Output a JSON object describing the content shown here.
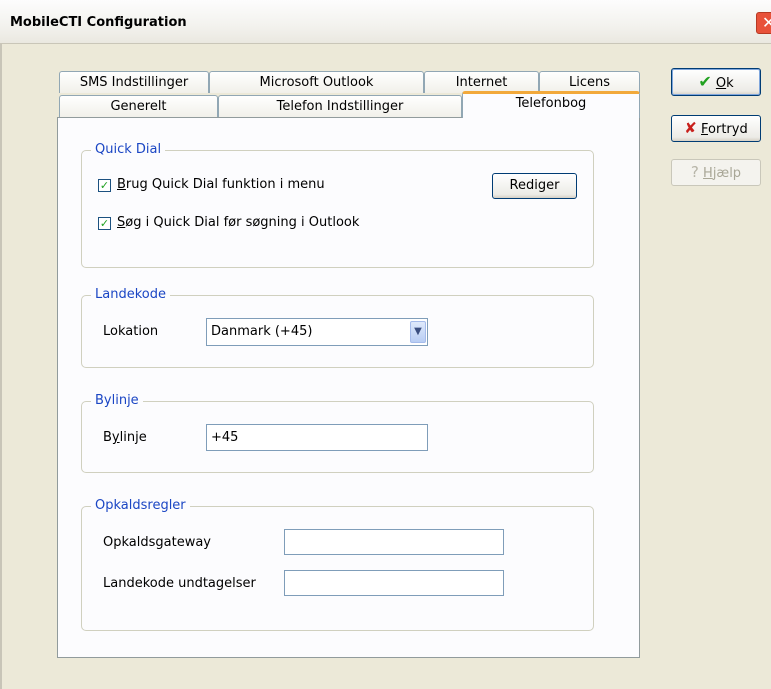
{
  "window": {
    "title": "MobileCTI Configuration",
    "close_glyph": "✕"
  },
  "tabs": {
    "row_back": [
      {
        "label": "SMS Indstillinger"
      },
      {
        "label": "Microsoft Outlook"
      },
      {
        "label": "Internet"
      },
      {
        "label": "Licens"
      }
    ],
    "row_front": [
      {
        "label": "Generelt"
      },
      {
        "label": "Telefon Indstillinger"
      },
      {
        "label": "Telefonbog",
        "active": true
      }
    ]
  },
  "buttons": {
    "ok": {
      "icon": "check-icon",
      "label": "Ok",
      "mnemonic": "O",
      "rest": "k"
    },
    "cancel": {
      "icon": "x-icon",
      "label": "Fortryd",
      "mnemonic": "F",
      "rest": "ortryd"
    },
    "help": {
      "icon": "question-icon",
      "label": "Hjælp",
      "mnemonic": "H",
      "rest": "jælp",
      "enabled": false
    }
  },
  "quick_dial": {
    "legend": "Quick Dial",
    "use_in_menu": {
      "checked": true,
      "mnemonic": "B",
      "rest": "rug Quick Dial funktion i menu"
    },
    "search_before_outlook": {
      "checked": true,
      "mnemonic": "S",
      "rest": "øg i Quick Dial før søgning i Outlook"
    },
    "edit_button": "Rediger"
  },
  "country_code": {
    "legend": "Landekode",
    "location_label": "Lokation",
    "location_value": "Danmark (+45)"
  },
  "city_line": {
    "legend": "Bylinje",
    "label_pre": "B",
    "label_mnemonic": "y",
    "label_rest": "linje",
    "value": "+45"
  },
  "dial_rules": {
    "legend": "Opkaldsregler",
    "gateway_label": "Opkaldsgateway",
    "gateway_value": "",
    "exceptions_label": "Landekode undtagelser",
    "exceptions_value": ""
  },
  "colors": {
    "legend_text": "#1b46c4",
    "active_tab_accent": "#f2a93b",
    "check_green": "#21a121",
    "cancel_red": "#c8201c"
  }
}
